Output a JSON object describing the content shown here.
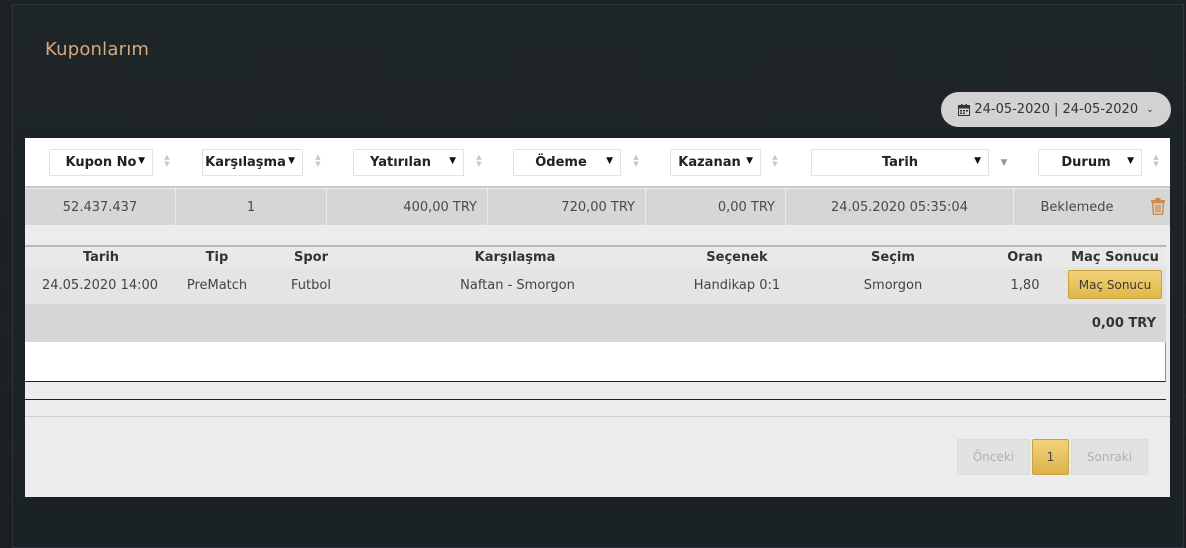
{
  "page": {
    "title": "Kuponlarım"
  },
  "date_filter": {
    "label": "24-05-2020 | 24-05-2020"
  },
  "filters": [
    {
      "label": "Kupon No"
    },
    {
      "label": "Karşılaşma"
    },
    {
      "label": "Yatırılan"
    },
    {
      "label": "Ödeme"
    },
    {
      "label": "Kazanan"
    },
    {
      "label": "Tarih"
    },
    {
      "label": "Durum"
    }
  ],
  "coupon": {
    "kupon_no": "52.437.437",
    "karsilasma": "1",
    "yatirilan": "400,00 TRY",
    "odeme": "720,00 TRY",
    "kazanan": "0,00 TRY",
    "tarih": "24.05.2020 05:35:04",
    "durum": "Beklemede"
  },
  "detail": {
    "headers": {
      "tarih": "Tarih",
      "tip": "Tip",
      "spor": "Spor",
      "karsilasma": "Karşılaşma",
      "secenek": "Seçenek",
      "secim": "Seçim",
      "oran": "Oran",
      "mac_sonucu": "Maç Sonucu"
    },
    "row": {
      "tarih": "24.05.2020 14:00",
      "tip": "PreMatch",
      "spor": "Futbol",
      "karsilasma": "Naftan - Smorgon",
      "secenek": "Handikap 0:1",
      "secim": "Smorgon",
      "oran": "1,80",
      "mac_sonucu_button": "Maç Sonucu"
    },
    "total": "0,00 TRY"
  },
  "pagination": {
    "prev": "Önceki",
    "current": "1",
    "next": "Sonraki"
  },
  "colors": {
    "accent_gold": "#e0b847",
    "title": "#d7a87c",
    "trash": "#c98a4a"
  }
}
